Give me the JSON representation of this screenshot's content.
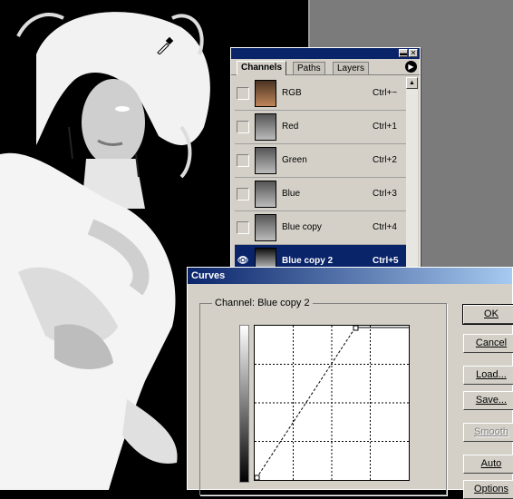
{
  "channels_palette": {
    "tabs": [
      {
        "label": "Channels"
      },
      {
        "label": "Paths"
      },
      {
        "label": "Layers"
      }
    ],
    "rows": [
      {
        "name": "RGB",
        "shortcut": "Ctrl+~"
      },
      {
        "name": "Red",
        "shortcut": "Ctrl+1"
      },
      {
        "name": "Green",
        "shortcut": "Ctrl+2"
      },
      {
        "name": "Blue",
        "shortcut": "Ctrl+3"
      },
      {
        "name": "Blue copy",
        "shortcut": "Ctrl+4"
      },
      {
        "name": "Blue copy 2",
        "shortcut": "Ctrl+5"
      }
    ],
    "selected_row": "Blue copy 2"
  },
  "curves_dialog": {
    "title": "Curves",
    "channel_label": "Channel:",
    "channel_value": "Blue copy 2",
    "buttons": {
      "ok": "OK",
      "cancel": "Cancel",
      "load": "Load...",
      "save": "Save...",
      "smooth": "Smooth",
      "auto": "Auto",
      "options": "Options"
    }
  },
  "colors": {
    "selection": "#0a246a",
    "dialog_face": "#d4d0c8",
    "workspace": "#7b7b7b"
  },
  "icons": [
    "eyedropper-icon",
    "eye-icon",
    "palette-menu-icon",
    "minimize-icon",
    "close-icon"
  ]
}
